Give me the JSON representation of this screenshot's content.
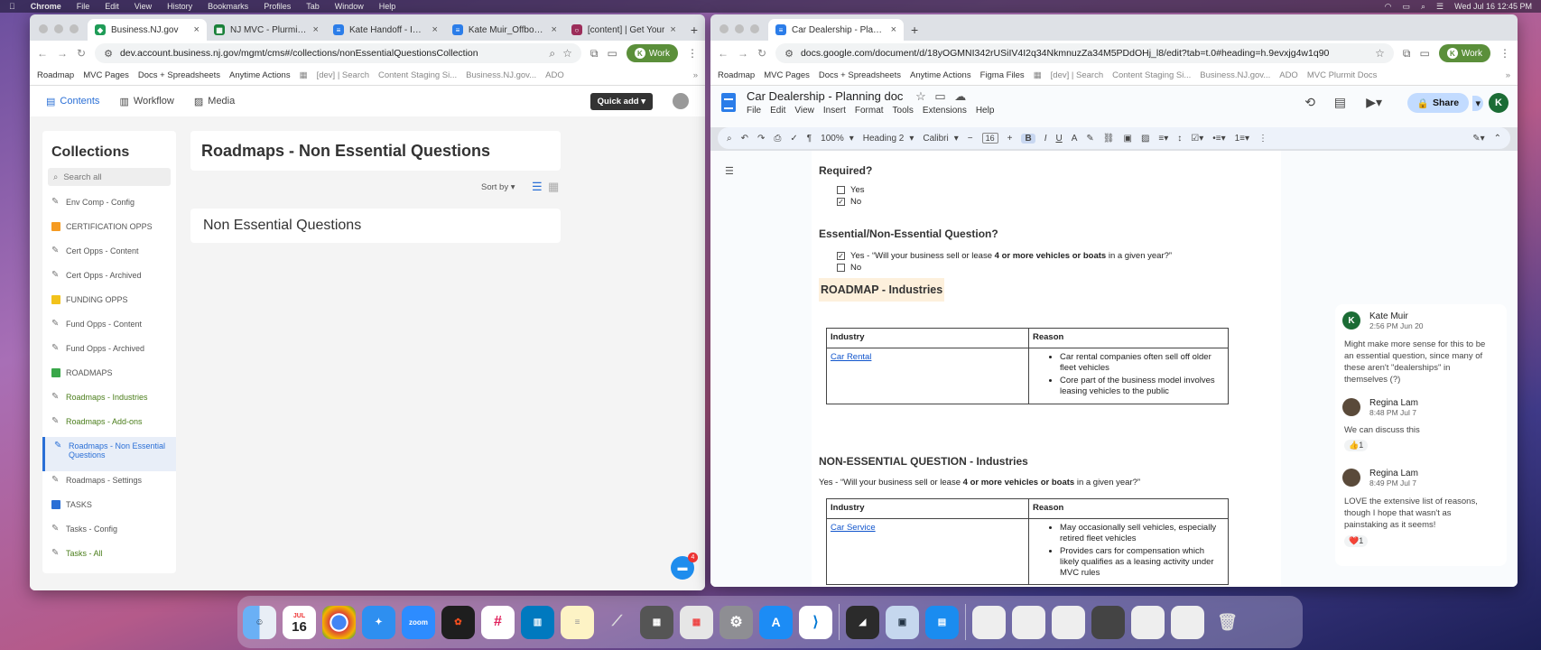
{
  "menubar": {
    "app": "Chrome",
    "items": [
      "File",
      "Edit",
      "View",
      "History",
      "Bookmarks",
      "Profiles",
      "Tab",
      "Window",
      "Help"
    ],
    "datetime": "Wed Jul 16 12:45 PM"
  },
  "left": {
    "tabs": [
      {
        "title": "Business.NJ.gov",
        "icon_color": "#1f9c57",
        "icon": "shield-icon"
      },
      {
        "title": "NJ MVC - Plurmit Tra",
        "icon_color": "#188038",
        "icon": "sheets-icon"
      },
      {
        "title": "Kate Handoff - Impo",
        "icon_color": "#2b7de9",
        "icon": "docs-icon"
      },
      {
        "title": "Kate Muir_Offboardi",
        "icon_color": "#2b7de9",
        "icon": "docs-icon"
      },
      {
        "title": "[content] | Get Your",
        "icon_color": "#9c2d5a",
        "icon": "globe-icon"
      }
    ],
    "url": "dev.account.business.nj.gov/mgmt/cms#/collections/nonEssentialQuestionsCollection",
    "profile_label": "Work",
    "bookmarks": [
      "Roadmap",
      "MVC Pages",
      "Docs + Spreadsheets",
      "Anytime Actions",
      "[dev] | Search",
      "Content Staging Si...",
      "Business.NJ.gov...",
      "ADO"
    ],
    "cms": {
      "nav": [
        "Contents",
        "Workflow",
        "Media"
      ],
      "quick_add": "Quick add",
      "collections_title": "Collections",
      "search_placeholder": "Search all",
      "items": [
        {
          "label": "Env Comp - Config",
          "icon": "pencil-icon"
        },
        {
          "label": "CERTIFICATION OPPS",
          "icon": "orange-square",
          "color": "#f59b22"
        },
        {
          "label": "Cert Opps - Content",
          "icon": "pencil-icon"
        },
        {
          "label": "Cert Opps - Archived",
          "icon": "pencil-icon"
        },
        {
          "label": "FUNDING OPPS",
          "icon": "yellow-square",
          "color": "#f2c21b"
        },
        {
          "label": "Fund Opps - Content",
          "icon": "pencil-icon"
        },
        {
          "label": "Fund Opps - Archived",
          "icon": "pencil-icon"
        },
        {
          "label": "ROADMAPS",
          "icon": "green-square",
          "color": "#3aa74a"
        },
        {
          "label": "Roadmaps - Industries",
          "icon": "pencil-icon"
        },
        {
          "label": "Roadmaps - Add-ons",
          "icon": "pencil-icon"
        },
        {
          "label": "Roadmaps - Non Essential Questions",
          "icon": "pencil-icon"
        },
        {
          "label": "Roadmaps - Settings",
          "icon": "pencil-icon"
        },
        {
          "label": "TASKS",
          "icon": "blue-square",
          "color": "#2a6fd6"
        },
        {
          "label": "Tasks - Config",
          "icon": "pencil-icon"
        },
        {
          "label": "Tasks - All",
          "icon": "pencil-icon"
        }
      ],
      "page_title": "Roadmaps - Non Essential Questions",
      "sort_by": "Sort by",
      "entry_title": "Non Essential Questions",
      "intercom_badge": "4"
    }
  },
  "right": {
    "tab_title": "Car Dealership - Planning doc",
    "url": "docs.google.com/document/d/18yOGMNI342rUSiIV4I2q34NkmnuzZa34M5PDdOHj_l8/edit?tab=t.0#heading=h.9evxjg4w1q90",
    "profile_label": "Work",
    "bookmarks": [
      "Roadmap",
      "MVC Pages",
      "Docs + Spreadsheets",
      "Anytime Actions",
      "Figma Files",
      "[dev] | Search",
      "Content Staging Si...",
      "Business.NJ.gov...",
      "ADO",
      "MVC Plurmit Docs"
    ],
    "doc_title": "Car Dealership - Planning doc",
    "doc_menu": [
      "File",
      "Edit",
      "View",
      "Insert",
      "Format",
      "Tools",
      "Extensions",
      "Help"
    ],
    "share_label": "Share",
    "user_initial": "K",
    "toolbar": {
      "zoom": "100%",
      "style": "Heading 2",
      "font": "Calibri",
      "size": "16"
    },
    "doc": {
      "required_h": "Required?",
      "required_opts": [
        {
          "label": "Yes",
          "checked": false
        },
        {
          "label": "No",
          "checked": true
        }
      ],
      "essential_h": "Essential/Non-Essential Question?",
      "essential_yes_prefix": "Yes - “Will your business sell or lease ",
      "essential_yes_bold": "4 or more vehicles or boats",
      "essential_yes_suffix": " in a given year?”",
      "essential_no": "No",
      "roadmap_h": "ROADMAP - Industries",
      "table1": {
        "headers": [
          "Industry",
          "Reason"
        ],
        "industry": "Car Rental",
        "reasons": [
          "Car rental companies often sell off older fleet vehicles",
          "Core part of the business model involves leasing vehicles to the public"
        ]
      },
      "noness_h": "NON-ESSENTIAL QUESTION - Industries",
      "noness_prefix": "Yes - “Will your business sell or lease ",
      "noness_bold": "4 or more vehicles or boats",
      "noness_suffix": " in a given year?”",
      "table2": {
        "headers": [
          "Industry",
          "Reason"
        ],
        "industry": "Car Service",
        "reasons": [
          "May occasionally sell vehicles, especially retired fleet vehicles",
          "Provides cars for compensation which likely qualifies as a leasing activity under MVC rules"
        ]
      }
    },
    "comments": [
      {
        "name": "Kate Muir",
        "time": "2:56 PM Jun 20",
        "text": "Might make more sense for this to be an essential question, since many of these aren't \"dealerships\" in themselves (?)",
        "avatar_initial": "K",
        "avatar_color": "#1b6c35"
      },
      {
        "name": "Regina Lam",
        "time": "8:48 PM Jul 7",
        "text": "We can discuss this",
        "reaction": "👍1",
        "avatar_color": "#5a4a3a"
      },
      {
        "name": "Regina Lam",
        "time": "8:49 PM Jul 7",
        "text": "LOVE the extensive list of reasons, though I hope that wasn't as painstaking as it seems!",
        "reaction": "❤️1",
        "avatar_color": "#5a4a3a"
      }
    ]
  },
  "dock": {
    "calendar_month": "JUL",
    "calendar_day": "16",
    "zoom_label": "zoom",
    "apps": [
      "Finder",
      "Calendar",
      "Chrome",
      "Safari",
      "Zoom",
      "Figma",
      "Slack",
      "Trello",
      "Notes",
      "Cursor",
      "Calculator",
      "Launchpad",
      "System Settings",
      "App Store",
      "VS Code",
      "Raycast",
      "Preview",
      "Keynote",
      "Trash"
    ]
  }
}
